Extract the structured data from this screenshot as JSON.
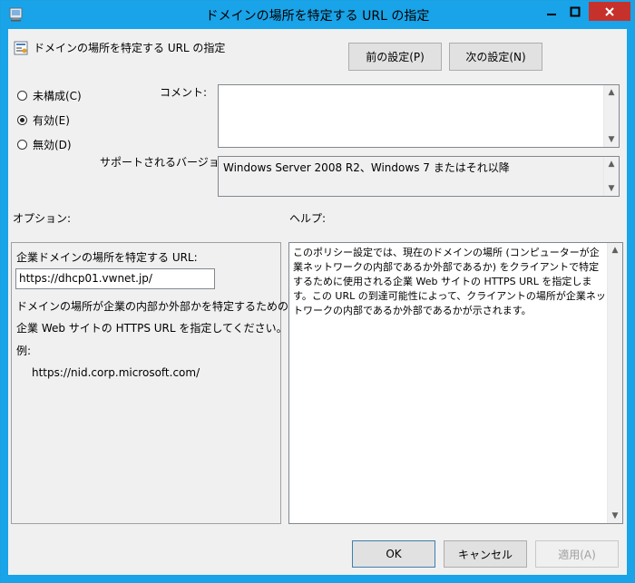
{
  "window": {
    "title": "ドメインの場所を特定する URL の指定",
    "minimize_glyph": "—",
    "maximize_glyph": "□",
    "close_glyph": "✕"
  },
  "header": {
    "policy_title": "ドメインの場所を特定する URL の指定",
    "prev_button": "前の設定(P)",
    "next_button": "次の設定(N)"
  },
  "state": {
    "options": [
      {
        "label": "未構成(C)",
        "checked": false
      },
      {
        "label": "有効(E)",
        "checked": true
      },
      {
        "label": "無効(D)",
        "checked": false
      }
    ]
  },
  "comment": {
    "label": "コメント:",
    "value": ""
  },
  "supported": {
    "label": "サポートされるバージョン:",
    "value": "Windows Server 2008 R2、Windows 7 またはそれ以降"
  },
  "options_section": {
    "label": "オプション:",
    "url_label": "企業ドメインの場所を特定する URL:",
    "url_value": "https://dhcp01.vwnet.jp/",
    "desc_line1": "ドメインの場所が企業の内部か外部かを特定するための",
    "desc_line2": "企業 Web サイトの HTTPS URL を指定してください。",
    "example_label": "例:",
    "example_url": "https://nid.corp.microsoft.com/"
  },
  "help_section": {
    "label": "ヘルプ:",
    "text": "このポリシー設定では、現在のドメインの場所 (コンピューターが企業ネットワークの内部であるか外部であるか) をクライアントで特定するために使用される企業 Web サイトの HTTPS URL を指定します。この URL の到達可能性によって、クライアントの場所が企業ネットワークの内部であるか外部であるかが示されます。"
  },
  "footer": {
    "ok": "OK",
    "cancel": "キャンセル",
    "apply": "適用(A)"
  },
  "colors": {
    "titlebar": "#19a3e8",
    "close": "#c7312b",
    "dialog_bg": "#f0f0f0"
  }
}
